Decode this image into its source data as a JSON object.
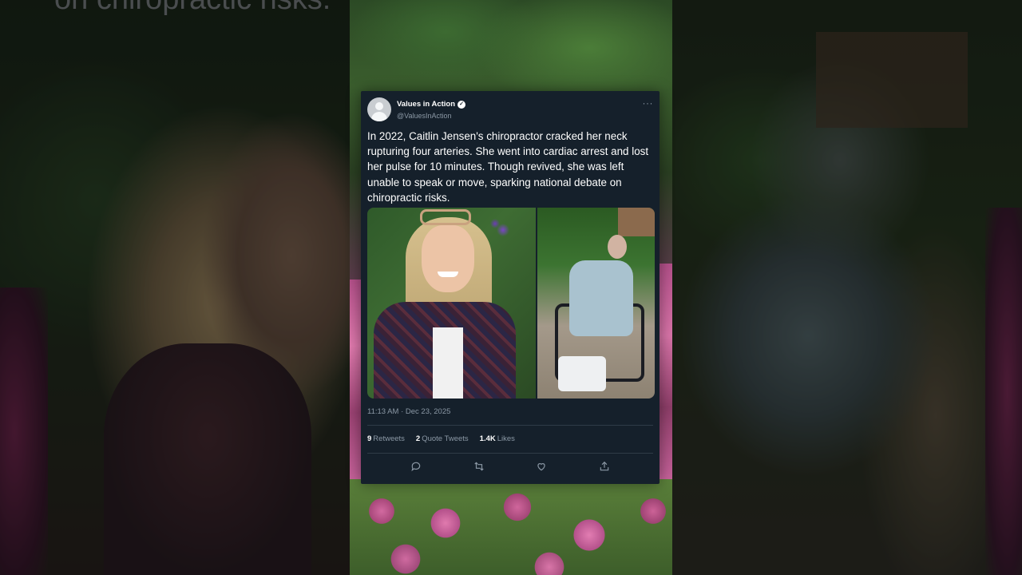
{
  "background": {
    "caption_fragment": "on chiropractic risks."
  },
  "tweet": {
    "display_name": "Values in Action",
    "verified_mark": "✓",
    "handle": "@ValuesInAction",
    "more_label": "···",
    "text": "In 2022, Caitlin Jensen's chiropractor cracked her neck rupturing four arteries. She went into cardiac arrest and lost her pulse for 10 minutes. Though revived, she was left unable to speak or move, sparking national debate on chiropractic risks.",
    "timestamp": "11:13 AM · Dec 23, 2025",
    "stats": {
      "retweets_count": "9",
      "retweets_label": "Retweets",
      "quotes_count": "2",
      "quotes_label": "Quote Tweets",
      "likes_count": "1.4K",
      "likes_label": "Likes"
    },
    "actions": [
      "reply-icon",
      "retweet-icon",
      "like-icon",
      "share-icon"
    ]
  },
  "colors": {
    "card_background": "#15202b",
    "secondary_text": "#8b98a5",
    "primary_text": "#ffffff"
  }
}
